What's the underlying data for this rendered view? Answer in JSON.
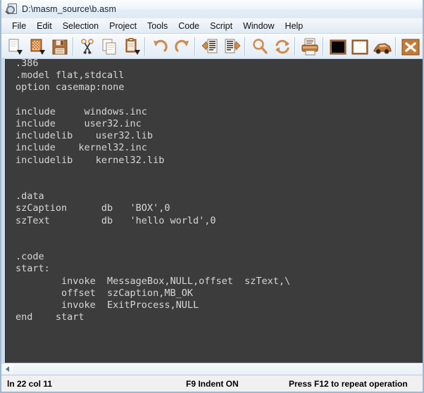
{
  "window": {
    "title": "D:\\masm_source\\b.asm",
    "icon": "document-magnifier-icon"
  },
  "menubar": {
    "items": [
      {
        "label": "File"
      },
      {
        "label": "Edit"
      },
      {
        "label": "Selection"
      },
      {
        "label": "Project"
      },
      {
        "label": "Tools"
      },
      {
        "label": "Code"
      },
      {
        "label": "Script"
      },
      {
        "label": "Window"
      },
      {
        "label": "Help"
      }
    ]
  },
  "toolbar": {
    "buttons": [
      {
        "name": "new-file-icon",
        "title": "New file"
      },
      {
        "name": "open-file-icon",
        "title": "Open file"
      },
      {
        "name": "save-file-icon",
        "title": "Save file"
      },
      {
        "name": "separator",
        "title": ""
      },
      {
        "name": "cut-icon",
        "title": "Cut"
      },
      {
        "name": "copy-icon",
        "title": "Copy"
      },
      {
        "name": "paste-icon",
        "title": "Paste"
      },
      {
        "name": "separator",
        "title": ""
      },
      {
        "name": "undo-icon",
        "title": "Undo"
      },
      {
        "name": "redo-icon",
        "title": "Redo"
      },
      {
        "name": "separator",
        "title": ""
      },
      {
        "name": "indent-left-icon",
        "title": "Indent left"
      },
      {
        "name": "indent-right-icon",
        "title": "Indent right"
      },
      {
        "name": "separator",
        "title": ""
      },
      {
        "name": "find-icon",
        "title": "Find"
      },
      {
        "name": "replace-icon",
        "title": "Replace"
      },
      {
        "name": "separator",
        "title": ""
      },
      {
        "name": "print-icon",
        "title": "Print"
      },
      {
        "name": "separator",
        "title": ""
      },
      {
        "name": "console-build-icon",
        "title": "Build console app"
      },
      {
        "name": "window-build-icon",
        "title": "Build windows app"
      },
      {
        "name": "run-icon",
        "title": "Run program"
      },
      {
        "name": "separator",
        "title": ""
      },
      {
        "name": "close-icon",
        "title": "Close"
      }
    ]
  },
  "editor": {
    "content": ".386\n.model flat,stdcall\noption casemap:none\n\ninclude     windows.inc\ninclude     user32.inc\nincludelib    user32.lib\ninclude    kernel32.inc\nincludelib    kernel32.lib\n\n\n.data\nszCaption      db   'BOX',0\nszText         db   'hello world',0\n\n\n.code\nstart:\n        invoke  MessageBox,NULL,offset  szText,\\\n        offset  szCaption,MB_OK\n        invoke  ExitProcess,NULL\nend    start",
    "scrollbar": {
      "left_arrow": "scroll-left-arrow-icon"
    }
  },
  "statusbar": {
    "position": "ln 22 col 11",
    "indent": "F9 Indent ON",
    "hint": "Press F12 to repeat operation"
  },
  "colors": {
    "editor_bg": "#3c3c3c",
    "editor_fg": "#d6d6d6",
    "chrome_bg": "#e8eff7",
    "icon_accent": "#c07a34",
    "close_red": "#c07a34"
  }
}
